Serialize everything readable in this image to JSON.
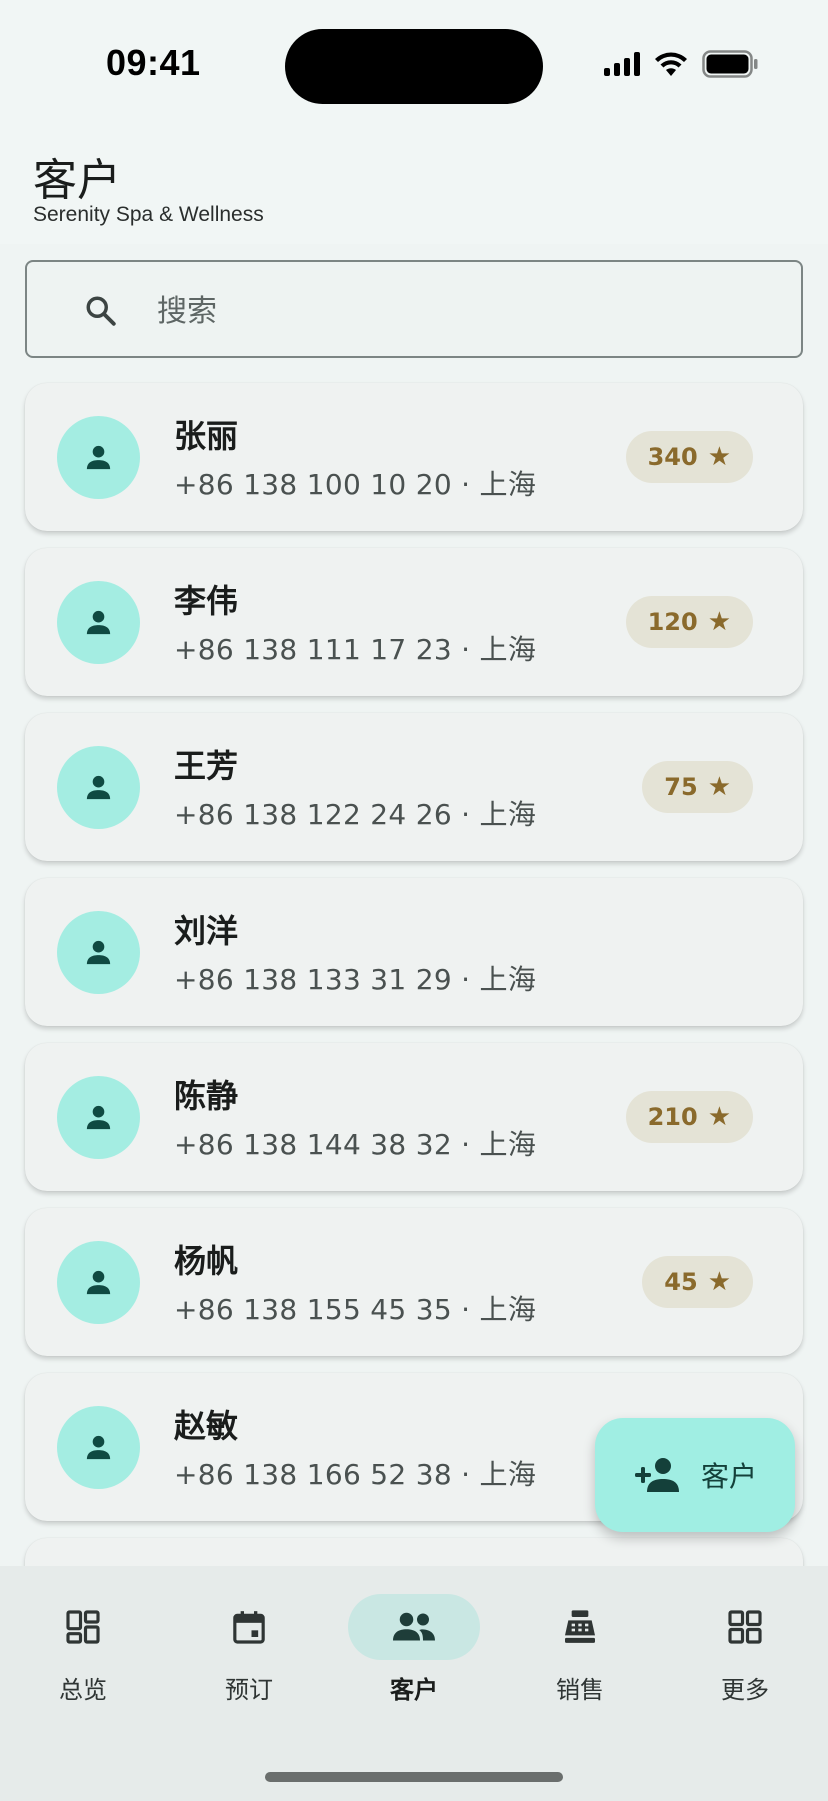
{
  "status_bar": {
    "time": "09:41"
  },
  "header": {
    "title": "客户",
    "subtitle": "Serenity Spa & Wellness"
  },
  "search": {
    "placeholder": "搜索"
  },
  "clients": [
    {
      "name": "张丽",
      "meta": "+86 138 100 10 20 · 上海",
      "points": "340"
    },
    {
      "name": "李伟",
      "meta": "+86 138 111 17 23 · 上海",
      "points": "120"
    },
    {
      "name": "王芳",
      "meta": "+86 138 122 24 26 · 上海",
      "points": "75"
    },
    {
      "name": "刘洋",
      "meta": "+86 138 133 31 29 · 上海",
      "points": ""
    },
    {
      "name": "陈静",
      "meta": "+86 138 144 38 32 · 上海",
      "points": "210"
    },
    {
      "name": "杨帆",
      "meta": "+86 138 155 45 35 · 上海",
      "points": "45"
    },
    {
      "name": "赵敏",
      "meta": "+86 138 166 52 38 · 上海",
      "points": ""
    }
  ],
  "fab": {
    "label": "客户"
  },
  "nav": {
    "items": [
      {
        "label": "总览",
        "icon": "dashboard-icon"
      },
      {
        "label": "预订",
        "icon": "calendar-icon"
      },
      {
        "label": "客户",
        "icon": "people-icon",
        "active": true
      },
      {
        "label": "销售",
        "icon": "register-icon"
      },
      {
        "label": "更多",
        "icon": "apps-grid-icon"
      }
    ]
  },
  "colors": {
    "accent": "#a4ede2",
    "accent_dark": "#14403a",
    "badge_bg": "#e4e3d6",
    "badge_text": "#8a6a2c"
  }
}
